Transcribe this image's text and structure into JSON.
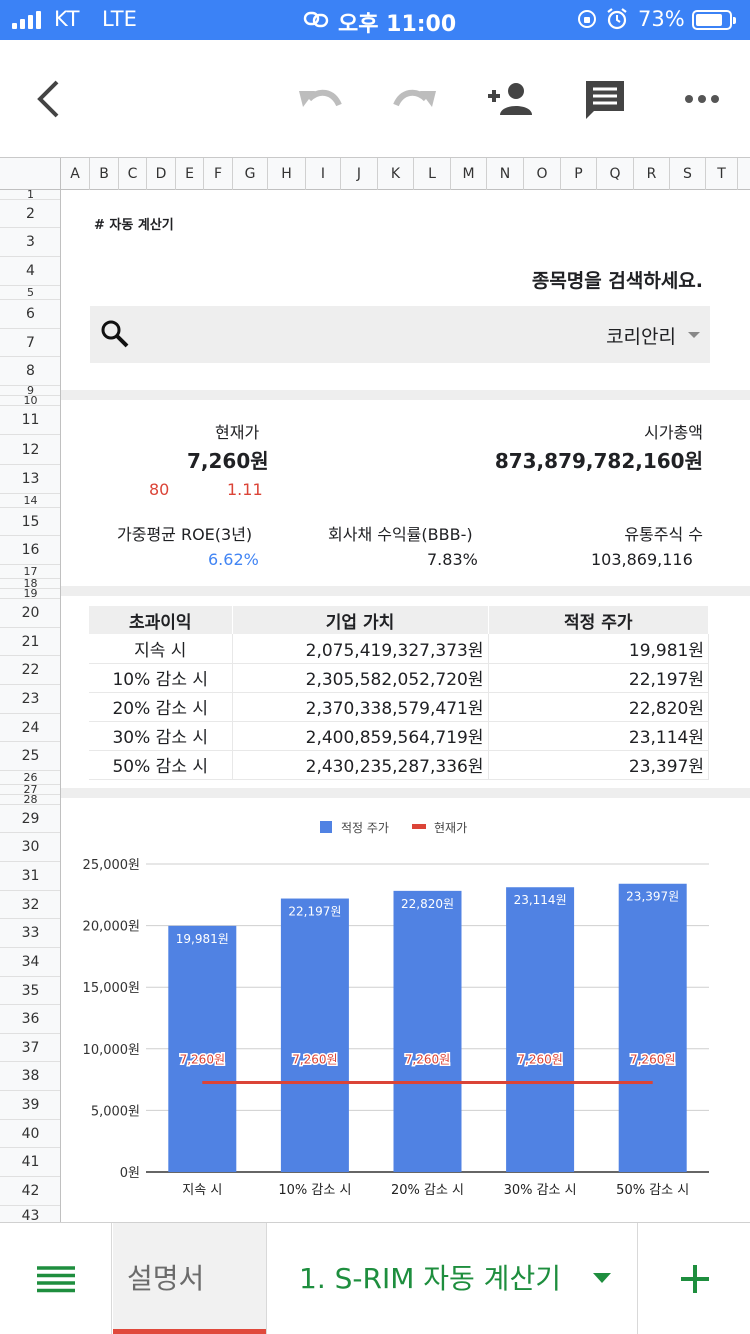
{
  "status_bar": {
    "carrier": "KT",
    "network": "LTE",
    "time": "오후 11:00",
    "battery_percent": "73%",
    "battery_level": 0.73,
    "icons": [
      "signal-icon",
      "link-icon",
      "orientation-lock-icon",
      "alarm-icon",
      "battery-icon"
    ]
  },
  "toolbar": {
    "icons": [
      "back-arrow-icon",
      "undo-icon",
      "redo-icon",
      "add-person-icon",
      "comment-icon",
      "more-icon"
    ]
  },
  "columns": [
    "A",
    "B",
    "C",
    "D",
    "E",
    "F",
    "G",
    "H",
    "I",
    "J",
    "K",
    "L",
    "M",
    "N",
    "O",
    "P",
    "Q",
    "R",
    "S",
    "T"
  ],
  "rows": [
    {
      "n": "1",
      "h": 10
    },
    {
      "n": "2",
      "h": 28
    },
    {
      "n": "3",
      "h": 29
    },
    {
      "n": "4",
      "h": 29
    },
    {
      "n": "5",
      "h": 14
    },
    {
      "n": "6",
      "h": 29
    },
    {
      "n": "7",
      "h": 28
    },
    {
      "n": "8",
      "h": 29
    },
    {
      "n": "9",
      "h": 10
    },
    {
      "n": "10",
      "h": 10
    },
    {
      "n": "11",
      "h": 29
    },
    {
      "n": "12",
      "h": 30
    },
    {
      "n": "13",
      "h": 29
    },
    {
      "n": "14",
      "h": 14
    },
    {
      "n": "15",
      "h": 28
    },
    {
      "n": "16",
      "h": 29
    },
    {
      "n": "17",
      "h": 14
    },
    {
      "n": "18",
      "h": 10
    },
    {
      "n": "19",
      "h": 10
    },
    {
      "n": "20",
      "h": 29
    },
    {
      "n": "21",
      "h": 28
    },
    {
      "n": "22",
      "h": 29
    },
    {
      "n": "23",
      "h": 29
    },
    {
      "n": "24",
      "h": 28
    },
    {
      "n": "25",
      "h": 29
    },
    {
      "n": "26",
      "h": 14
    },
    {
      "n": "27",
      "h": 10
    },
    {
      "n": "28",
      "h": 10
    },
    {
      "n": "29",
      "h": 28
    },
    {
      "n": "30",
      "h": 29
    },
    {
      "n": "31",
      "h": 29
    },
    {
      "n": "32",
      "h": 28
    },
    {
      "n": "33",
      "h": 29
    },
    {
      "n": "34",
      "h": 29
    },
    {
      "n": "35",
      "h": 28
    },
    {
      "n": "36",
      "h": 29
    },
    {
      "n": "37",
      "h": 28
    },
    {
      "n": "38",
      "h": 29
    },
    {
      "n": "39",
      "h": 29
    },
    {
      "n": "40",
      "h": 28
    },
    {
      "n": "41",
      "h": 29
    },
    {
      "n": "42",
      "h": 29
    },
    {
      "n": "43",
      "h": 20
    }
  ],
  "sheet": {
    "title": "# 자동 계산기",
    "search_prompt": "종목명을 검색하세요.",
    "selected_stock": "코리안리",
    "current_price_label": "현재가",
    "current_price": "7,260원",
    "price_change": "80",
    "price_change_pct": "1.11",
    "market_cap_label": "시가총액",
    "market_cap": "873,879,782,160원",
    "roe_label": "가중평균 ROE(3년)",
    "roe_value": "6.62%",
    "bond_label": "회사채 수익률(BBB-)",
    "bond_value": "7.83%",
    "shares_label": "유통주식 수",
    "shares_value": "103,869,116"
  },
  "table": {
    "headers": [
      "초과이익",
      "기업 가치",
      "적정 주가"
    ],
    "rows": [
      [
        "지속 시",
        "2,075,419,327,373원",
        "19,981원"
      ],
      [
        "10% 감소 시",
        "2,305,582,052,720원",
        "22,197원"
      ],
      [
        "20% 감소 시",
        "2,370,338,579,471원",
        "22,820원"
      ],
      [
        "30% 감소 시",
        "2,400,859,564,719원",
        "23,114원"
      ],
      [
        "50% 감소 시",
        "2,430,235,287,336원",
        "23,397원"
      ]
    ]
  },
  "chart_data": {
    "type": "bar",
    "title": "",
    "xlabel": "",
    "ylabel": "",
    "categories": [
      "지속 시",
      "10% 감소 시",
      "20% 감소 시",
      "30% 감소 시",
      "50% 감소 시"
    ],
    "series": [
      {
        "name": "적정 주가",
        "type": "bar",
        "color": "#5082e3",
        "values": [
          19981,
          22197,
          22820,
          23114,
          23397
        ],
        "labels": [
          "19,981원",
          "22,197원",
          "22,820원",
          "23,114원",
          "23,397원"
        ]
      },
      {
        "name": "현재가",
        "type": "line",
        "color": "#db4437",
        "values": [
          7260,
          7260,
          7260,
          7260,
          7260
        ],
        "labels": [
          "7,260원",
          "7,260원",
          "7,260원",
          "7,260원",
          "7,260원"
        ]
      }
    ],
    "yticks": [
      "0원",
      "5,000원",
      "10,000원",
      "15,000원",
      "20,000원",
      "25,000원"
    ],
    "ylim": [
      0,
      25000
    ],
    "grid": true,
    "legend_position": "top"
  },
  "bottom_bar": {
    "tabs": [
      {
        "label": "설명서",
        "active": false
      },
      {
        "label": "1. S-RIM 자동 계산기",
        "active": true
      }
    ]
  },
  "colors": {
    "status_bar": "#3b82f6",
    "negative_red": "#db4437",
    "positive_blue": "#4285f4",
    "active_tab_green": "#1e8e3e",
    "bar_blue": "#5082e3"
  }
}
